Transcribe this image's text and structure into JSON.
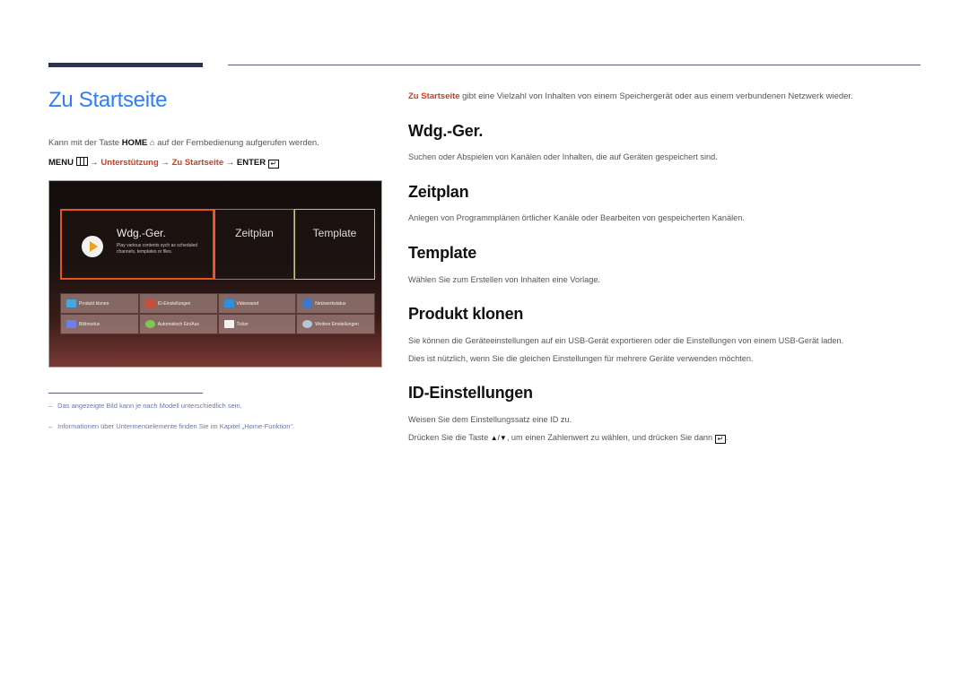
{
  "page": {
    "title": "Zu Startseite",
    "intro": {
      "before": "Kann mit der Taste ",
      "key": "HOME",
      "home_icon": "⌂",
      "after": " auf der Fernbedienung aufgerufen werden."
    },
    "menu_path": {
      "menu": "MENU",
      "arrow": "→",
      "step1": "Unterstützung",
      "step2": "Zu Startseite",
      "enter": "ENTER",
      "enter_icon": "↵"
    }
  },
  "screen": {
    "main_tile": {
      "title": "Wdg.-Ger.",
      "subtitle": "Play various contents sych as scheduled channels, templates or files."
    },
    "tiles": [
      {
        "label": "Zeitplan"
      },
      {
        "label": "Template"
      }
    ],
    "grid": [
      {
        "label": "Produkt klonen",
        "icon": "clone-icon",
        "color": "#4aa6e0"
      },
      {
        "label": "ID-Einstellungen",
        "icon": "id-card-icon",
        "color": "#c8503a"
      },
      {
        "label": "Videowand",
        "icon": "video-wall-icon",
        "color": "#2f8fd8"
      },
      {
        "label": "Netzwerkstatus",
        "icon": "network-status-icon",
        "color": "#3a78d0"
      },
      {
        "label": "Bildmodus",
        "icon": "picture-mode-icon",
        "color": "#6f80e8"
      },
      {
        "label": "Automatisch Ein/Aus",
        "icon": "power-timer-icon",
        "color": "#7ec850"
      },
      {
        "label": "Ticker",
        "icon": "ticker-icon",
        "color": "#f2f2f2"
      },
      {
        "label": "Weitere Einstellungen",
        "icon": "gear-icon",
        "color": "#b8c4d8"
      }
    ]
  },
  "footnotes": [
    "Das angezeigte Bild kann je nach Modell unterschiedlich sein.",
    "Informationen über Untermenüelemente finden Sie im Kapitel „Home-Funktion“."
  ],
  "content": {
    "lead_highlight": "Zu Startseite",
    "lead_rest": " gibt eine Vielzahl von Inhalten von einem Speichergerät oder aus einem verbundenen Netzwerk wieder.",
    "sections": [
      {
        "heading": "Wdg.-Ger.",
        "lines": [
          "Suchen oder Abspielen von Kanälen oder Inhalten, die auf Geräten gespeichert sind."
        ]
      },
      {
        "heading": "Zeitplan",
        "lines": [
          "Anlegen von Programmplänen örtlicher Kanäle oder Bearbeiten von gespeicherten Kanälen."
        ]
      },
      {
        "heading": "Template",
        "lines": [
          "Wählen Sie zum Erstellen von Inhalten eine Vorlage."
        ]
      },
      {
        "heading": "Produkt klonen",
        "lines": [
          "Sie können die Geräteeinstellungen auf ein USB-Gerät exportieren oder die Einstellungen von einem USB-Gerät laden.",
          "Dies ist nützlich, wenn Sie die gleichen Einstellungen für mehrere Geräte verwenden möchten."
        ]
      },
      {
        "heading": "ID-Einstellungen",
        "lines": [
          "Weisen Sie dem Einstellungssatz eine ID zu."
        ]
      }
    ],
    "id_press": {
      "before": "Drücken Sie die Taste ",
      "keys": "▲/▼",
      "middle": ", um einen Zahlenwert zu wählen, und drücken Sie dann ",
      "enter_icon": "↵",
      "end": "."
    }
  },
  "colors": {
    "title_blue": "#2d7ff9",
    "highlight_red": "#d23c1e",
    "focus_orange": "#e8541e",
    "footnote_blue": "#6b78a8"
  }
}
